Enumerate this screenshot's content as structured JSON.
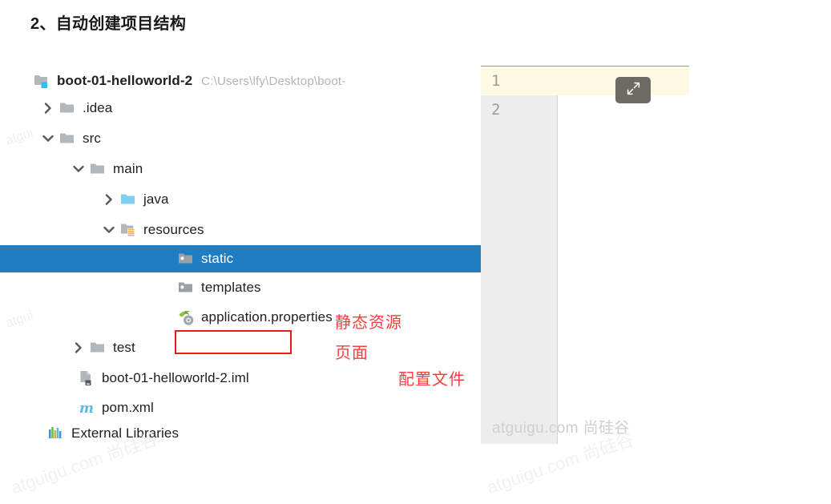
{
  "heading": "2、自动创建项目结构",
  "tree": {
    "rows": [
      {
        "label": "boot-01-helloworld-2",
        "path": "C:\\Users\\lfy\\Desktop\\boot-",
        "icon": "module-folder-icon",
        "arrow": "none",
        "indent": 20,
        "bold": true,
        "selected": false
      },
      {
        "label": ".idea",
        "path": "",
        "icon": "folder-icon",
        "arrow": "collapsed",
        "indent": 52,
        "bold": false,
        "selected": false
      },
      {
        "label": "src",
        "path": "",
        "icon": "folder-icon",
        "arrow": "expanded",
        "indent": 52,
        "bold": false,
        "selected": false
      },
      {
        "label": "main",
        "path": "",
        "icon": "folder-icon",
        "arrow": "expanded",
        "indent": 90,
        "bold": false,
        "selected": false
      },
      {
        "label": "java",
        "path": "",
        "icon": "source-folder-icon",
        "arrow": "collapsed",
        "indent": 128,
        "bold": false,
        "selected": false
      },
      {
        "label": "resources",
        "path": "",
        "icon": "resource-folder-icon",
        "arrow": "expanded",
        "indent": 128,
        "bold": false,
        "selected": false
      },
      {
        "label": "static",
        "path": "",
        "icon": "excluded-folder-icon",
        "arrow": "none",
        "indent": 200,
        "bold": false,
        "selected": true
      },
      {
        "label": "templates",
        "path": "",
        "icon": "excluded-folder-icon",
        "arrow": "none",
        "indent": 200,
        "bold": false,
        "selected": false
      },
      {
        "label": "application.properties",
        "path": "",
        "icon": "spring-properties-icon",
        "arrow": "none",
        "indent": 200,
        "bold": false,
        "selected": false
      },
      {
        "label": "test",
        "path": "",
        "icon": "folder-icon",
        "arrow": "collapsed",
        "indent": 90,
        "bold": false,
        "selected": false
      },
      {
        "label": "boot-01-helloworld-2.iml",
        "path": "",
        "icon": "iml-file-icon",
        "arrow": "none",
        "indent": 76,
        "bold": false,
        "selected": false
      },
      {
        "label": "pom.xml",
        "path": "",
        "icon": "maven-icon",
        "arrow": "none",
        "indent": 76,
        "bold": false,
        "selected": false
      },
      {
        "label": "External Libraries",
        "path": "",
        "icon": "libraries-icon",
        "arrow": "none",
        "indent": 38,
        "bold": false,
        "selected": false
      }
    ]
  },
  "annotations": {
    "static_resources": "静态资源",
    "pages": "页面",
    "config_file": "配置文件"
  },
  "editor": {
    "line_numbers": [
      "1",
      "2"
    ],
    "current_line": "1",
    "expand_button_icon": "expand-fullscreen-icon",
    "watermark": "atguigu.com 尚硅谷"
  },
  "watermarks": {
    "bottom_left": "atguigu.com 尚硅谷",
    "bottom_middle": "atguigu.com 尚硅谷",
    "side_1": "atgui",
    "side_2": "atgui"
  },
  "colors": {
    "selection_blue": "#1f7ec1",
    "annotation_red": "#fb3e3e",
    "box_red": "#ef1b1b",
    "gutter_bg": "#ededed",
    "current_line_bg": "#fdf9e3",
    "source_folder": "#7ed0ef",
    "folder_gray": "#b2b7bb"
  }
}
